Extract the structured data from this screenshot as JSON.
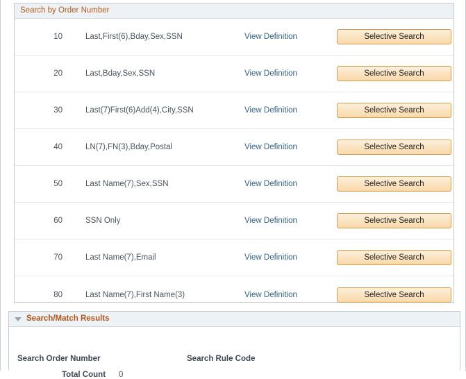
{
  "order_panel": {
    "title": "Search by Order Number",
    "rows": [
      {
        "order_number": "10",
        "description": "Last,First(6),Bday,Sex,SSN",
        "link_label": "View Definition",
        "button_label": "Selective Search"
      },
      {
        "order_number": "20",
        "description": "Last,Bday,Sex,SSN",
        "link_label": "View Definition",
        "button_label": "Selective Search"
      },
      {
        "order_number": "30",
        "description": "Last(7)First(6)Add(4),City,SSN",
        "link_label": "View Definition",
        "button_label": "Selective Search"
      },
      {
        "order_number": "40",
        "description": "LN(7),FN(3),Bday,Postal",
        "link_label": "View Definition",
        "button_label": "Selective Search"
      },
      {
        "order_number": "50",
        "description": "Last Name(7),Sex,SSN",
        "link_label": "View Definition",
        "button_label": "Selective Search"
      },
      {
        "order_number": "60",
        "description": "SSN Only",
        "link_label": "View Definition",
        "button_label": "Selective Search"
      },
      {
        "order_number": "70",
        "description": "Last Name(7),Email",
        "link_label": "View Definition",
        "button_label": "Selective Search"
      },
      {
        "order_number": "80",
        "description": "Last Name(7),First Name(3)",
        "link_label": "View Definition",
        "button_label": "Selective Search"
      }
    ]
  },
  "results_panel": {
    "title": "Search/Match Results",
    "collapse_icon": "triangle-down-icon",
    "search_order_number_label": "Search Order Number",
    "search_order_number_value": "",
    "search_rule_code_label": "Search Rule Code",
    "search_rule_code_value": "",
    "total_count_label": "Total Count",
    "total_count_value": "0"
  },
  "colors": {
    "panel_header_bg": "#eef2f4",
    "panel_title_text": "#b25a1e",
    "link": "#34618a",
    "button_border": "#d99b4a",
    "button_bg": "#fbe3c0",
    "panel_border": "#c3cbd2",
    "row_separator": "#e6e8ea"
  }
}
